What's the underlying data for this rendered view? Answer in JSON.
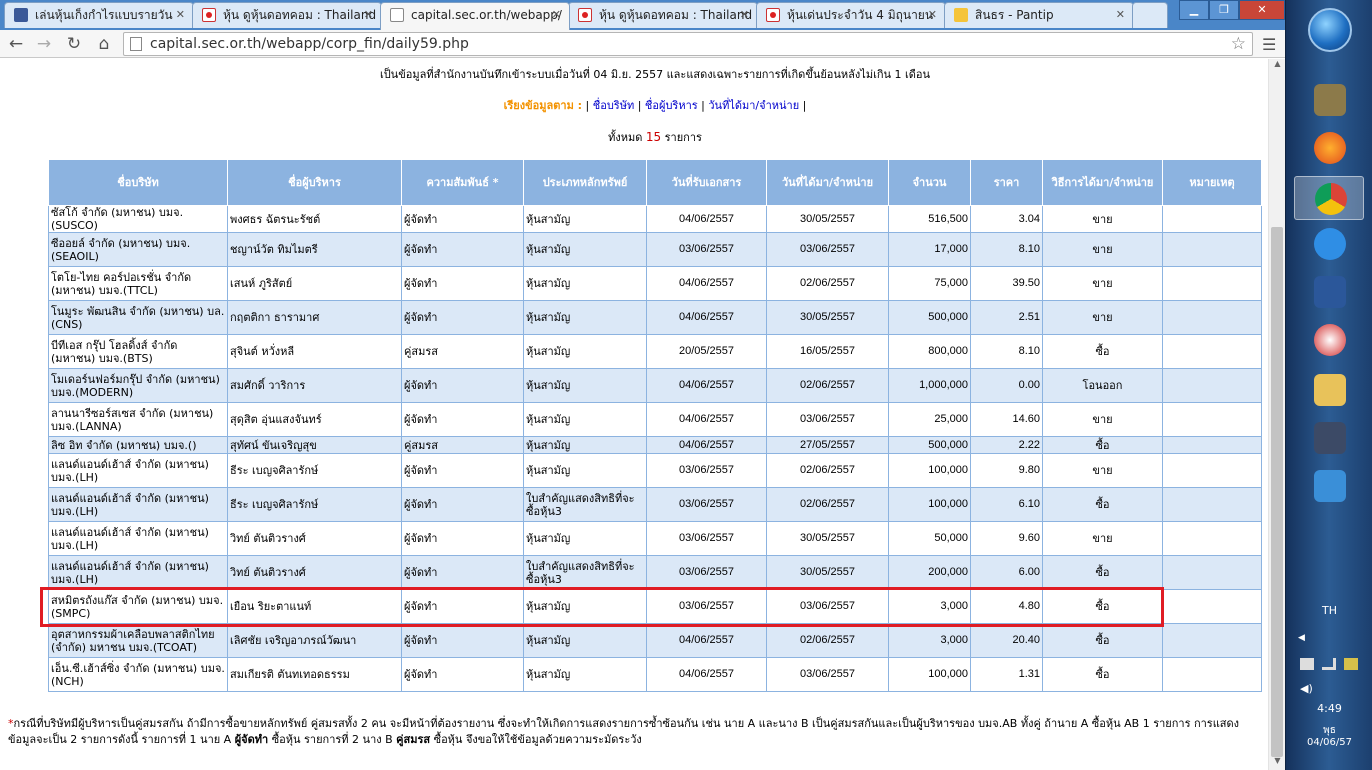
{
  "browser": {
    "tabs": [
      {
        "label": "เล่นหุ้นเก็งกำไรแบบรายวัน",
        "favicon": "facebook-icon",
        "active": false
      },
      {
        "label": "หุ้น ดูหุ้นดอทคอม : Thailand",
        "favicon": "doohoon-icon",
        "active": false
      },
      {
        "label": "capital.sec.or.th/webapp/",
        "favicon": "page-icon",
        "active": true
      },
      {
        "label": "หุ้น ดูหุ้นดอทคอม : Thailand",
        "favicon": "doohoon-icon",
        "active": false
      },
      {
        "label": "หุ้นเด่นประจำวัน 4 มิถุนายน",
        "favicon": "doohoon-icon",
        "active": false
      },
      {
        "label": "สินธร - Pantip",
        "favicon": "pantip-icon",
        "active": false
      }
    ],
    "url": "capital.sec.or.th/webapp/corp_fin/daily59.php"
  },
  "page": {
    "info_line": "เป็นข้อมูลที่สำนักงานบันทึกเข้าระบบเมื่อวันที่ 04 มิ.ย. 2557 และแสดงเฉพาะรายการที่เกิดขึ้นย้อนหลังไม่เกิน 1 เดือน",
    "sort_label": "เรียงข้อมูลตาม :",
    "sort_links": [
      "ชื่อบริษัท",
      "ชื่อผู้บริหาร",
      "วันที่ได้มา/จำหน่าย"
    ],
    "total_prefix": "ทั้งหมด",
    "total_count": "15",
    "total_suffix": "รายการ",
    "columns": [
      "ชื่อบริษัท",
      "ชื่อผู้บริหาร",
      "ความสัมพันธ์ *",
      "ประเภทหลักทรัพย์",
      "วันที่รับเอกสาร",
      "วันที่ได้มา/จำหน่าย",
      "จำนวน",
      "ราคา",
      "วิธีการได้มา/จำหน่าย",
      "หมายเหตุ"
    ],
    "rows": [
      [
        "ซัสโก้ จำกัด (มหาชน) บมจ.(SUSCO)",
        "พงศธร ฉัตรนะรัชต์",
        "ผู้จัดทำ",
        "หุ้นสามัญ",
        "04/06/2557",
        "30/05/2557",
        "516,500",
        "3.04",
        "ขาย",
        ""
      ],
      [
        "ซีออยล์ จำกัด (มหาชน) บมจ.(SEAOIL)",
        "ชญาน์วัต ทิมไมตรี",
        "ผู้จัดทำ",
        "หุ้นสามัญ",
        "03/06/2557",
        "03/06/2557",
        "17,000",
        "8.10",
        "ขาย",
        ""
      ],
      [
        "โตโย-ไทย คอร์ปอเรชั่น จำกัด (มหาชน) บมจ.(TTCL)",
        "เสนห์ ภูริสัตย์",
        "ผู้จัดทำ",
        "หุ้นสามัญ",
        "04/06/2557",
        "02/06/2557",
        "75,000",
        "39.50",
        "ขาย",
        ""
      ],
      [
        "โนมูระ พัฒนสิน จำกัด (มหาชน) บล.(CNS)",
        "กฤตติกา ธารามาศ",
        "ผู้จัดทำ",
        "หุ้นสามัญ",
        "04/06/2557",
        "30/05/2557",
        "500,000",
        "2.51",
        "ขาย",
        ""
      ],
      [
        "บีทีเอส กรุ๊ป โฮลดิ้งส์ จำกัด (มหาชน) บมจ.(BTS)",
        "สุจินต์ หวั่งหลี",
        "คู่สมรส",
        "หุ้นสามัญ",
        "20/05/2557",
        "16/05/2557",
        "800,000",
        "8.10",
        "ซื้อ",
        ""
      ],
      [
        "โมเดอร์นฟอร์มกรุ๊ป จำกัด (มหาชน) บมจ.(MODERN)",
        "สมศักดิ์ วาริการ",
        "ผู้จัดทำ",
        "หุ้นสามัญ",
        "04/06/2557",
        "02/06/2557",
        "1,000,000",
        "0.00",
        "โอนออก",
        ""
      ],
      [
        "ลานนารีซอร์สเซส จำกัด (มหาชน) บมจ.(LANNA)",
        "สุดุสิต อุ่นแสงจันทร์",
        "ผู้จัดทำ",
        "หุ้นสามัญ",
        "04/06/2557",
        "03/06/2557",
        "25,000",
        "14.60",
        "ขาย",
        ""
      ],
      [
        "ลิซ อิท จำกัด (มหาชน) บมจ.()",
        "สุทัศน์ ขันเจริญสุข",
        "คู่สมรส",
        "หุ้นสามัญ",
        "04/06/2557",
        "27/05/2557",
        "500,000",
        "2.22",
        "ซื้อ",
        ""
      ],
      [
        "แลนด์แอนด์เฮ้าส์ จำกัด (มหาชน) บมจ.(LH)",
        "ธีระ เบญจศิลารักษ์",
        "ผู้จัดทำ",
        "หุ้นสามัญ",
        "03/06/2557",
        "02/06/2557",
        "100,000",
        "9.80",
        "ขาย",
        ""
      ],
      [
        "แลนด์แอนด์เฮ้าส์ จำกัด (มหาชน) บมจ.(LH)",
        "ธีระ เบญจศิลารักษ์",
        "ผู้จัดทำ",
        "ใบสำคัญแสดงสิทธิที่จะซื้อหุ้น3",
        "03/06/2557",
        "02/06/2557",
        "100,000",
        "6.10",
        "ซื้อ",
        ""
      ],
      [
        "แลนด์แอนด์เฮ้าส์ จำกัด (มหาชน) บมจ.(LH)",
        "วิทย์ ตันติวรางศ์",
        "ผู้จัดทำ",
        "หุ้นสามัญ",
        "03/06/2557",
        "30/05/2557",
        "50,000",
        "9.60",
        "ขาย",
        ""
      ],
      [
        "แลนด์แอนด์เฮ้าส์ จำกัด (มหาชน) บมจ.(LH)",
        "วิทย์ ตันติวรางศ์",
        "ผู้จัดทำ",
        "ใบสำคัญแสดงสิทธิที่จะซื้อหุ้น3",
        "03/06/2557",
        "30/05/2557",
        "200,000",
        "6.00",
        "ซื้อ",
        ""
      ],
      [
        "สหมิตรถังแก๊ส จำกัด (มหาชน) บมจ.(SMPC)",
        "เยือน ริยะตาแนท์",
        "ผู้จัดทำ",
        "หุ้นสามัญ",
        "03/06/2557",
        "03/06/2557",
        "3,000",
        "4.80",
        "ซื้อ",
        ""
      ],
      [
        "อุตสาหกรรมผ้าเคลือบพลาสติกไทย (จำกัด) มหาชน บมจ.(TCOAT)",
        "เลิศชัย เจริญอาภรณ์วัฒนา",
        "ผู้จัดทำ",
        "หุ้นสามัญ",
        "04/06/2557",
        "02/06/2557",
        "3,000",
        "20.40",
        "ซื้อ",
        ""
      ],
      [
        "เอ็น.ซี.เฮ้าส์ซิ่ง จำกัด (มหาชน) บมจ.(NCH)",
        "สมเกียรติ ตันทเทอดธรรม",
        "ผู้จัดทำ",
        "หุ้นสามัญ",
        "04/06/2557",
        "03/06/2557",
        "100,000",
        "1.31",
        "ซื้อ",
        ""
      ]
    ],
    "highlighted_row": 12,
    "footnote_star": "*",
    "footnote_a": "กรณีที่บริษัทมีผู้บริหารเป็นคู่สมรสกัน ถ้ามีการซื้อขายหลักทรัพย์ คู่สมรสทั้ง 2 คน จะมีหน้าที่ต้องรายงาน ซึ่งจะทำให้เกิดการแสดงรายการซ้ำซ้อนกัน เช่น นาย A และนาง B เป็นคู่สมรสกันและเป็นผู้บริหารของ บมจ.AB ทั้งคู่ ถ้านาย A ซื้อหุ้น AB 1 รายการ การแสดงข้อมูลจะเป็น 2 รายการดังนี้ รายการที่ 1 นาย A",
    "footnote_bold1": "ผู้จัดทำ",
    "footnote_b": "ซื้อหุ้น รายการที่ 2 นาง B",
    "footnote_bold2": "คู่สมรส",
    "footnote_c": "ซื้อหุ้น จึงขอให้ใช้ข้อมูลด้วยความระมัดระวัง"
  },
  "taskbar": {
    "language": "TH",
    "time": "4:49",
    "day": "พุธ",
    "date": "04/06/57"
  },
  "colors": {
    "header_bg": "#8cb3e0",
    "alt_row_bg": "#dbe8f7",
    "sort_label": "#f39200",
    "count": "#cc0000",
    "highlight_border": "#e01c24"
  }
}
